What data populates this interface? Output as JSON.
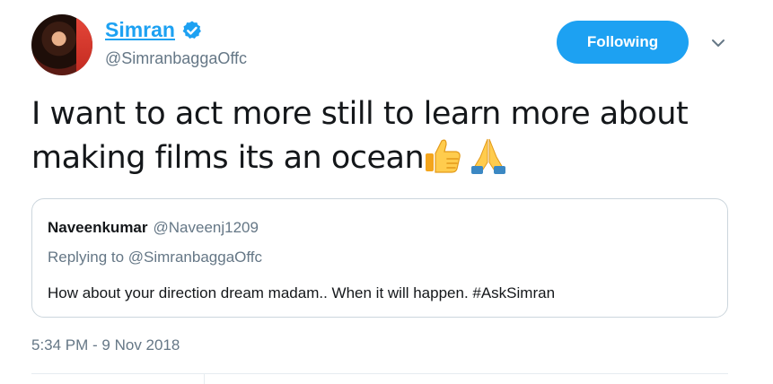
{
  "author": {
    "display_name": "Simran",
    "handle": "@SimranbaggaOffc",
    "verified_icon": "verified-badge-icon"
  },
  "follow_button": {
    "label": "Following"
  },
  "menu": {
    "icon": "chevron-down-icon"
  },
  "tweet": {
    "text": "I want to act more still to learn more about making films its an ocean",
    "emojis": [
      "thumbs-up-icon",
      "folded-hands-icon"
    ],
    "timestamp": "5:34 PM - 9 Nov 2018"
  },
  "quoted_tweet": {
    "author_name": "Naveenkumar",
    "author_handle": "@Naveenj1209",
    "replying_to": "Replying to @SimranbaggaOffc",
    "text": "How about your direction dream madam.. When it will happen. #AskSimran"
  },
  "colors": {
    "accent": "#1da1f2",
    "secondary_text": "#657786",
    "border": "#ccd6dd"
  }
}
